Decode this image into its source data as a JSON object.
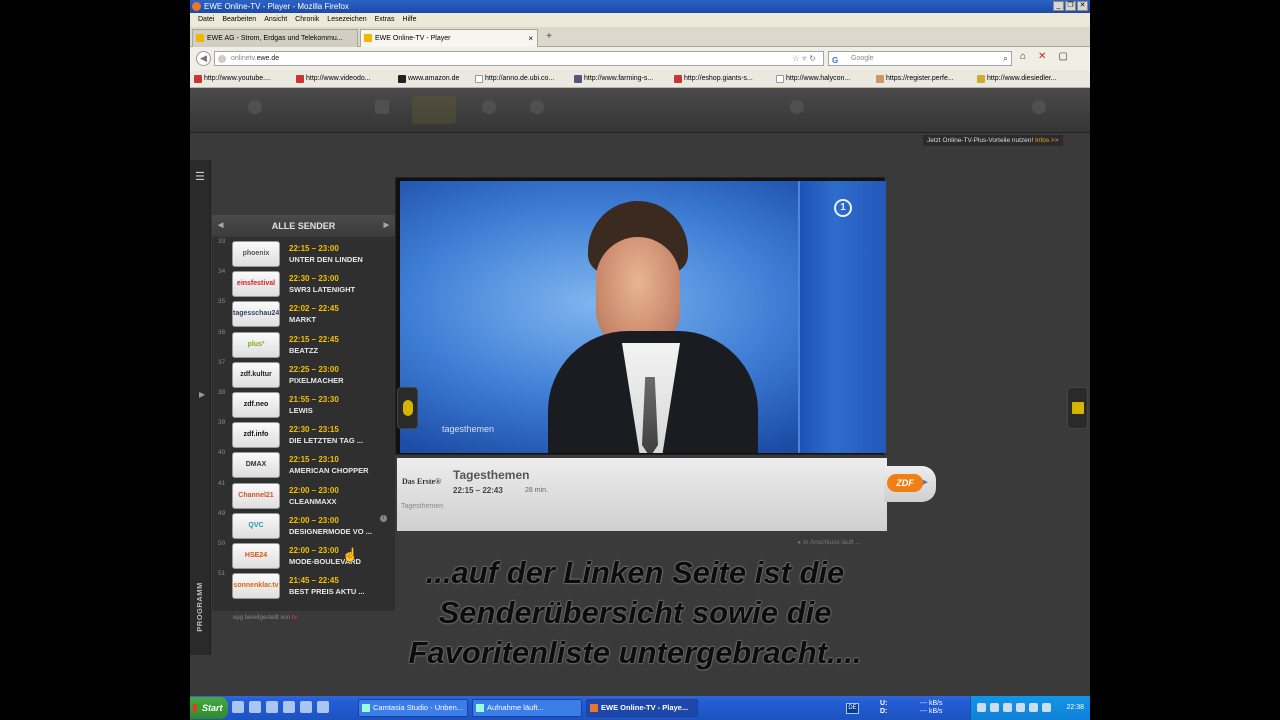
{
  "window": {
    "title": "EWE Online-TV - Player - Mozilla Firefox",
    "buttons": [
      "_",
      "❐",
      "✕"
    ]
  },
  "menu": [
    "Datei",
    "Bearbeiten",
    "Ansicht",
    "Chronik",
    "Lesezeichen",
    "Extras",
    "Hilfe"
  ],
  "tabs": [
    {
      "label": "EWE AG - Strom, Erdgas und Telekommu...",
      "active": false
    },
    {
      "label": "EWE Online-TV - Player",
      "active": true,
      "close": "×"
    }
  ],
  "newtab": "+",
  "nav": {
    "url_prefix": "onlinetv.",
    "url_domain": "ewe.de",
    "search_placeholder": "Google",
    "search_logo": "G"
  },
  "bookmarks": [
    "http://www.youtube....",
    "http://www.videodo...",
    "www.amazon.de",
    "http://anno.de.ubi.co...",
    "http://www.farming-s...",
    "http://eshop.giants-s...",
    "http://www.halycon...",
    "https://register.perfe...",
    "http://www.diesiedler..."
  ],
  "promo": {
    "text": "Jetzt Online-TV-Plus-Vorteile nutzen!",
    "link": "Infos >>"
  },
  "panel": {
    "title": "ALLE SENDER",
    "side_label": "PROGRAMM",
    "channels": [
      {
        "num": "33",
        "logo": "phoenix",
        "logo_color": "#555555",
        "time": "22:15 – 23:00",
        "title": "UNTER DEN LINDEN"
      },
      {
        "num": "34",
        "logo": "einsfestival",
        "logo_color": "#cc2222",
        "time": "22:30 – 23:00",
        "title": "SWR3 LATENIGHT"
      },
      {
        "num": "35",
        "logo": "tagesschau24",
        "logo_color": "#334466",
        "time": "22:02 – 22:45",
        "title": "MARKT"
      },
      {
        "num": "36",
        "logo": "plus³",
        "logo_color": "#88aa11",
        "time": "22:15 – 22:45",
        "title": "BEATZZ"
      },
      {
        "num": "37",
        "logo": "zdf.kultur",
        "logo_color": "#222222",
        "time": "22:25 – 23:00",
        "title": "PIXELMACHER"
      },
      {
        "num": "38",
        "logo": "zdf.neo",
        "logo_color": "#111111",
        "time": "21:55 – 23:30",
        "title": "LEWIS"
      },
      {
        "num": "39",
        "logo": "zdf.info",
        "logo_color": "#111111",
        "time": "22:30 – 23:15",
        "title": "DIE LETZTEN TAG ..."
      },
      {
        "num": "40",
        "logo": "DMAX",
        "logo_color": "#333333",
        "time": "22:15 – 23:10",
        "title": "AMERICAN CHOPPER"
      },
      {
        "num": "41",
        "logo": "Channel21",
        "logo_color": "#cc5522",
        "time": "22:00 – 23:00",
        "title": "CLEANMAXX"
      },
      {
        "num": "49",
        "logo": "QVC",
        "logo_color": "#2299aa",
        "time": "22:00 – 23:00",
        "title": "DESIGNERMODE VO ...",
        "info": "i"
      },
      {
        "num": "50",
        "logo": "HSE24",
        "logo_color": "#e05010",
        "time": "22:00 – 23:00",
        "title": "MODE-BOULEVARD"
      },
      {
        "num": "51",
        "logo": "sonnenklar.tv",
        "logo_color": "#dd6611",
        "time": "21:45 – 22:45",
        "title": "BEST PREIS AKTU ..."
      }
    ],
    "credit_prefix": "epg bereitgestellt von",
    "credit_brand": "tv"
  },
  "player": {
    "watermark": "tagesthemen",
    "channel_logo": "1",
    "station": "Das Erste®",
    "show": "Tagesthemen",
    "time": "22:15 – 22:43",
    "duration": "28 min.",
    "subtitle": "Tagesthemen",
    "next_channel": "ZDF",
    "archive": "In Anschluss läuft ..."
  },
  "caption": [
    "...auf der Linken Seite ist die",
    "Senderübersicht sowie die",
    "Favoritenliste untergebracht...."
  ],
  "taskbar": {
    "start": "Start",
    "tasks": [
      {
        "label": "Camtasia Studio - Unben...",
        "active": false
      },
      {
        "label": "Aufnahme läuft...",
        "active": false
      },
      {
        "label": "EWE Online-TV - Playe...",
        "active": true
      }
    ],
    "lang": "DE",
    "net_up": "U:",
    "net_down": "D:",
    "kbs1": "--- kB/s",
    "kbs2": "--- kB/s",
    "clock": "22:38"
  }
}
